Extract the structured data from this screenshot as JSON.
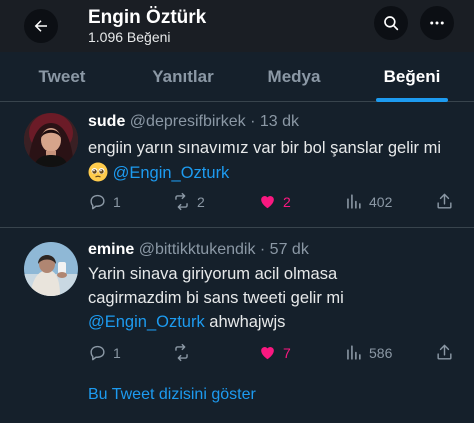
{
  "header": {
    "title": "Engin Öztürk",
    "subtitle": "1.096 Beğeni"
  },
  "tabs": [
    {
      "label": "Tweet",
      "active": false
    },
    {
      "label": "Yanıtlar",
      "active": false
    },
    {
      "label": "Medya",
      "active": false
    },
    {
      "label": "Beğeni",
      "active": true
    }
  ],
  "tweets": [
    {
      "name": "sude",
      "handle": "@depresifbirkek",
      "separator": "·",
      "time": "13 dk",
      "text": "engiin yarın sınavımız var bir bol şanslar gelir mi",
      "emoji": "pleading-face",
      "mention": "@Engin_Ozturk",
      "replies": "1",
      "retweets": "2",
      "likes": "2",
      "views": "402"
    },
    {
      "name": "emine",
      "handle": "@bittikktukendik",
      "separator": "·",
      "time": "57 dk",
      "text": "Yarin sinava giriyorum acil olmasa cagirmazdim bi sans tweeti gelir mi",
      "mention": "@Engin_Ozturk",
      "suffix": " ahwhajwjs",
      "replies": "1",
      "retweets": "",
      "likes": "7",
      "views": "586"
    }
  ],
  "show_thread_label": "Bu Tweet dizisini göster",
  "colors": {
    "background": "#15202b",
    "accent": "#1d9bf0",
    "like": "#f91880",
    "muted": "#8b98a5"
  }
}
